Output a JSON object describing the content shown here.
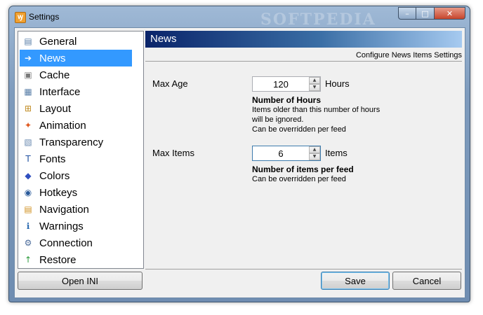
{
  "window": {
    "title": "Settings",
    "watermark": "SOFTPEDIA",
    "controls": {
      "minimize": "–",
      "maximize": "□",
      "close": "✕"
    }
  },
  "sidebar": {
    "items": [
      {
        "label": "General",
        "icon": "general-icon",
        "glyph": "▤",
        "color": "#5a7fa8",
        "selected": false
      },
      {
        "label": "News",
        "icon": "news-icon",
        "glyph": "➔",
        "color": "#ffffff",
        "selected": true
      },
      {
        "label": "Cache",
        "icon": "cache-icon",
        "glyph": "▣",
        "color": "#7a7a7a",
        "selected": false
      },
      {
        "label": "Interface",
        "icon": "interface-icon",
        "glyph": "▦",
        "color": "#5a7fa8",
        "selected": false
      },
      {
        "label": "Layout",
        "icon": "layout-icon",
        "glyph": "⊞",
        "color": "#c08a20",
        "selected": false
      },
      {
        "label": "Animation",
        "icon": "animation-icon",
        "glyph": "✦",
        "color": "#e05a20",
        "selected": false
      },
      {
        "label": "Transparency",
        "icon": "transparency-icon",
        "glyph": "▧",
        "color": "#6a8ab0",
        "selected": false
      },
      {
        "label": "Fonts",
        "icon": "fonts-icon",
        "glyph": "T",
        "color": "#2050a0",
        "selected": false
      },
      {
        "label": "Colors",
        "icon": "colors-icon",
        "glyph": "◆",
        "color": "#3050c0",
        "selected": false
      },
      {
        "label": "Hotkeys",
        "icon": "hotkeys-icon",
        "glyph": "◉",
        "color": "#2a5a9a",
        "selected": false
      },
      {
        "label": "Navigation",
        "icon": "navigation-icon",
        "glyph": "▤",
        "color": "#d09020",
        "selected": false
      },
      {
        "label": "Warnings",
        "icon": "warnings-icon",
        "glyph": "ℹ",
        "color": "#2a6ab0",
        "selected": false
      },
      {
        "label": "Connection",
        "icon": "connection-icon",
        "glyph": "⚙",
        "color": "#4a6a9a",
        "selected": false
      },
      {
        "label": "Restore",
        "icon": "restore-icon",
        "glyph": "↑",
        "color": "#2a9a3a",
        "selected": false
      }
    ],
    "open_ini_label": "Open INI"
  },
  "panel": {
    "title": "News",
    "subtitle": "Configure News Items Settings",
    "max_age": {
      "label": "Max Age",
      "value": "120",
      "unit": "Hours",
      "help_title": "Number of Hours",
      "help_lines": [
        "Items older than this number of hours",
        "will be ignored.",
        "Can be overridden per feed"
      ]
    },
    "max_items": {
      "label": "Max Items",
      "value": "6",
      "unit": "Items",
      "help_title": "Number of items per feed",
      "help_lines": [
        "Can be overridden per feed"
      ]
    }
  },
  "footer": {
    "save_label": "Save",
    "cancel_label": "Cancel"
  }
}
